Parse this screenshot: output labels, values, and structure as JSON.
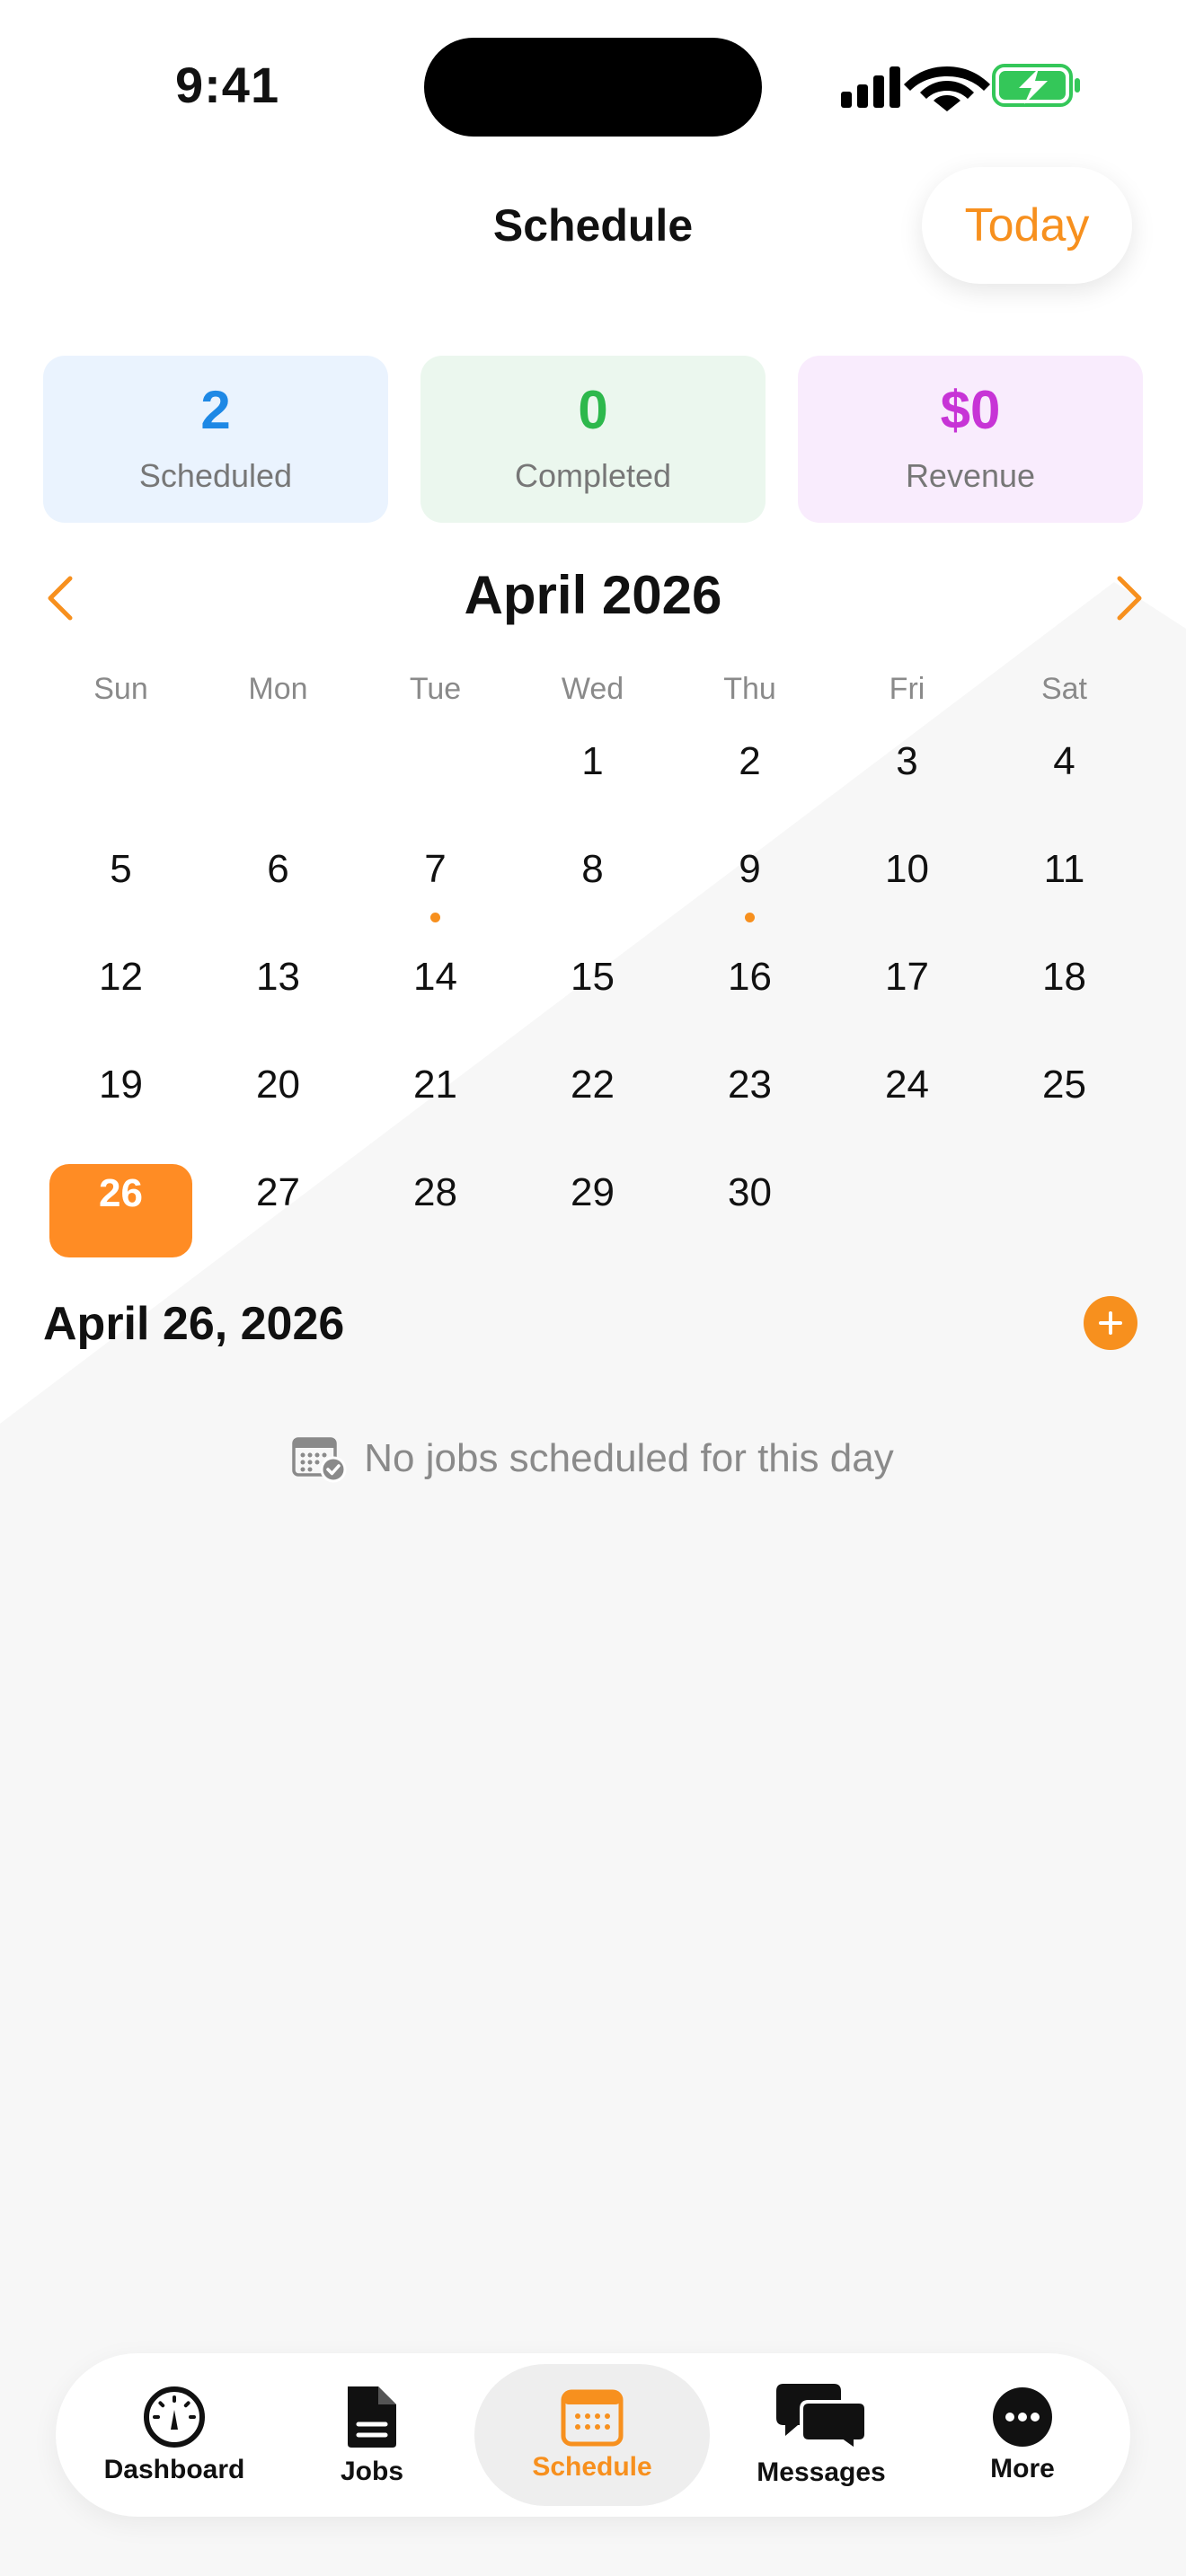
{
  "status_bar": {
    "time": "9:41"
  },
  "header": {
    "title": "Schedule",
    "today_label": "Today"
  },
  "stats": [
    {
      "value": "2",
      "label": "Scheduled"
    },
    {
      "value": "0",
      "label": "Completed"
    },
    {
      "value": "$0",
      "label": "Revenue"
    }
  ],
  "calendar": {
    "month_label": "April 2026",
    "weekdays": [
      "Sun",
      "Mon",
      "Tue",
      "Wed",
      "Thu",
      "Fri",
      "Sat"
    ],
    "days": [
      "1",
      "2",
      "3",
      "4",
      "5",
      "6",
      "7",
      "8",
      "9",
      "10",
      "11",
      "12",
      "13",
      "14",
      "15",
      "16",
      "17",
      "18",
      "19",
      "20",
      "21",
      "22",
      "23",
      "24",
      "25",
      "26",
      "27",
      "28",
      "29",
      "30"
    ],
    "selected_day": "26",
    "days_with_jobs": [
      "7",
      "9"
    ]
  },
  "selected": {
    "date_label": "April 26, 2026",
    "empty_message": "No jobs scheduled for this day"
  },
  "tabs": [
    {
      "label": "Dashboard",
      "icon": "gauge-icon"
    },
    {
      "label": "Jobs",
      "icon": "document-icon"
    },
    {
      "label": "Schedule",
      "icon": "calendar-icon"
    },
    {
      "label": "Messages",
      "icon": "chat-bubbles-icon"
    },
    {
      "label": "More",
      "icon": "more-icon"
    }
  ],
  "colors": {
    "accent": "#F7901E",
    "scheduled": "#1E88E5",
    "completed": "#2DB84C",
    "revenue": "#C734D6",
    "battery": "#34C759"
  }
}
